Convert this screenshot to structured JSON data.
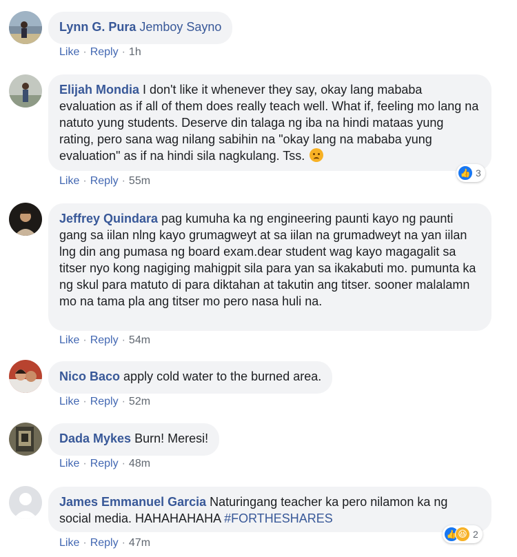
{
  "actions": {
    "like": "Like",
    "reply": "Reply",
    "separator": "·"
  },
  "comments": [
    {
      "author": "Lynn G. Pura",
      "tag": "Jemboy Sayno",
      "text": "",
      "time": "1h"
    },
    {
      "author": "Elijah Mondia",
      "text": "I don't like it whenever they say, okay lang mababa evaluation as if all of them does really teach well. What if, feeling mo lang na natuto yung students. Deserve din talaga ng iba na hindi mataas yung rating, pero sana wag nilang sabihin na \"okay lang na mababa yung evaluation\" as if na hindi sila nagkulang. Tss.",
      "emoji": "sad-face-emoji",
      "time": "55m",
      "reaction_count": "3",
      "reaction_icons": [
        "like-icon"
      ]
    },
    {
      "author": "Jeffrey Quindara",
      "text": "pag kumuha ka ng engineering paunti kayo ng paunti gang sa iilan nlng kayo grumagweyt at sa iilan na grumadweyt na yan iilan lng din ang pumasa ng board exam.dear student wag kayo magagalit sa titser nyo kong nagiging mahigpit sila para yan sa ikakabuti mo. pumunta ka ng skul para matuto di para diktahan at takutin ang titser. sooner malalamn mo na tama pla ang titser mo pero nasa huli na.",
      "time": "54m"
    },
    {
      "author": "Nico Baco",
      "text": "apply cold water to the burned area.",
      "time": "52m"
    },
    {
      "author": "Dada Mykes",
      "text": "Burn! Meresi!",
      "time": "48m"
    },
    {
      "author": "James Emmanuel Garcia",
      "text": "Naturingang teacher ka pero nilamon ka ng social media. HAHAHAHAHA",
      "hashtag": "#FORTHESHARES",
      "time": "47m",
      "reaction_count": "2",
      "reaction_icons": [
        "like-icon",
        "haha-icon"
      ]
    }
  ],
  "colors": {
    "name": "#385898",
    "link": "#4267b2",
    "bubble": "#f2f3f5",
    "like": "#1877f2",
    "haha": "#f7b125"
  }
}
